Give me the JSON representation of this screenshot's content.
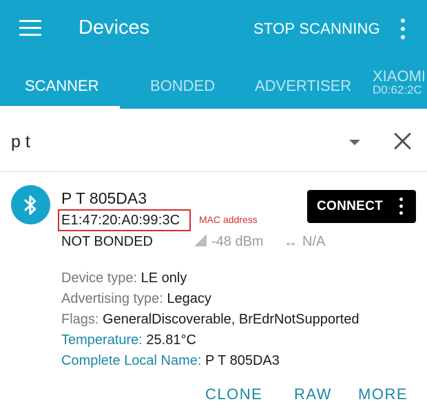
{
  "appbar": {
    "title": "Devices",
    "stop_label": "STOP SCANNING"
  },
  "tabs": [
    {
      "label": "SCANNER"
    },
    {
      "label": "BONDED"
    },
    {
      "label": "ADVERTISER"
    },
    {
      "label": "XIAOMI",
      "sub": "D0:62:2C"
    }
  ],
  "filter": {
    "value": "p t"
  },
  "device": {
    "name": "P T 805DA3",
    "mac": "E1:47:20:A0:99:3C",
    "mac_annotation": "MAC address",
    "bond_state": "NOT BONDED",
    "rssi": "-48 dBm",
    "interval": "N/A",
    "connect_label": "CONNECT",
    "details": [
      {
        "key": "Device type:",
        "value": "LE only"
      },
      {
        "key": "Advertising type:",
        "value": "Legacy"
      },
      {
        "key": "Flags:",
        "value": "GeneralDiscoverable, BrEdrNotSupported"
      },
      {
        "key": "Temperature:",
        "value": "25.81°C"
      },
      {
        "key": "Complete Local Name:",
        "value": "P T 805DA3"
      }
    ]
  },
  "actions": {
    "clone": "CLONE",
    "raw": "RAW",
    "more": "MORE"
  },
  "colors": {
    "primary": "#15a5cc",
    "accent_text": "#1b87a6",
    "annotation": "#d32f2f"
  },
  "icons": [
    "menu-icon",
    "overflow-menu-icon",
    "dropdown-arrow-icon",
    "close-icon",
    "bluetooth-icon",
    "signal-icon",
    "interval-arrows-icon"
  ]
}
